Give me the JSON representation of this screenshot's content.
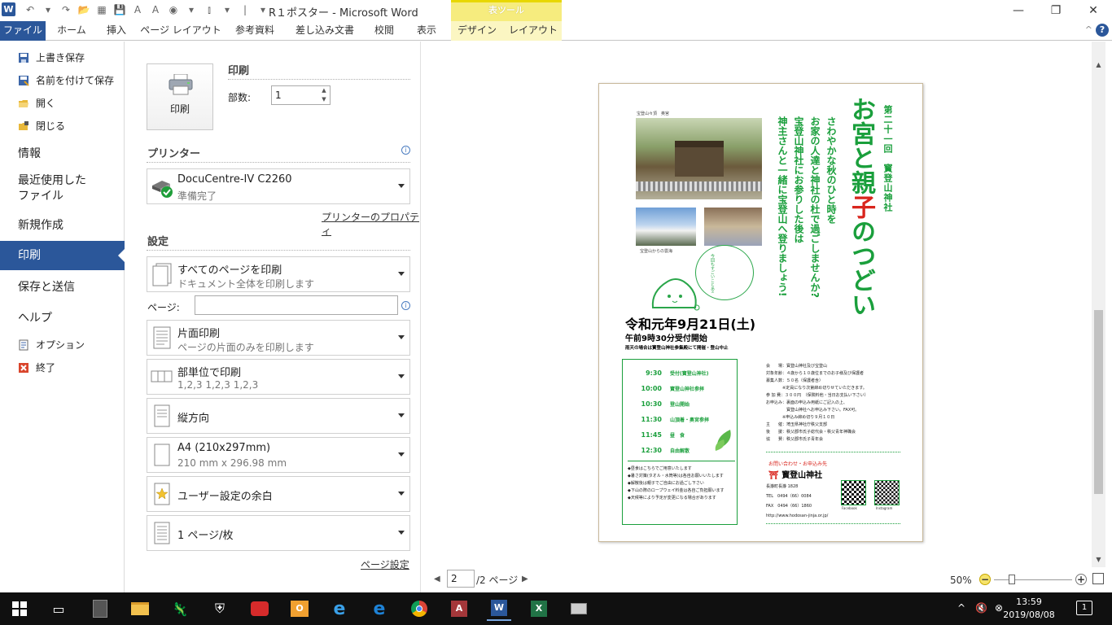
{
  "titlebar": {
    "title": "R１ポスター  -  Microsoft Word",
    "tool_group": "表ツール",
    "qat": [
      "↶",
      "▾",
      "↷",
      "📂",
      "▦",
      "💾",
      "A",
      "A",
      "◉",
      "▾",
      "⫾",
      "▾",
      "|",
      "▾"
    ],
    "controls": [
      "—",
      "❐",
      "✕"
    ]
  },
  "ribbon": {
    "tabs": [
      "ファイル",
      "ホーム",
      "挿入",
      "ページ レイアウト",
      "参考資料",
      "差し込み文書",
      "校閲",
      "表示",
      "デザイン",
      "レイアウト"
    ],
    "minimize": "^"
  },
  "nav": {
    "save": "上書き保存",
    "save_as": "名前を付けて保存",
    "open": "開く",
    "close": "閉じる",
    "info": "情報",
    "recent_line1": "最近使用した",
    "recent_line2": "ファイル",
    "new": "新規作成",
    "print": "印刷",
    "save_send": "保存と送信",
    "help": "ヘルプ",
    "options": "オプション",
    "exit": "終了"
  },
  "print_panel": {
    "print_button": "印刷",
    "print_heading": "印刷",
    "copies_label": "部数:",
    "copies_value": "1",
    "printer_heading": "プリンター",
    "printer_name": "DocuCentre-IV C2260",
    "printer_status": "準備完了",
    "printer_properties": "プリンターのプロパティ",
    "settings_heading": "設定",
    "pages_label": "ページ:",
    "pages_value": "",
    "settings": [
      {
        "line1": "すべてのページを印刷",
        "line2": "ドキュメント全体を印刷します"
      },
      {
        "line1": "片面印刷",
        "line2": "ページの片面のみを印刷します"
      },
      {
        "line1": "部単位で印刷",
        "line2": "1,2,3    1,2,3    1,2,3"
      },
      {
        "line1": "縦方向",
        "line2": ""
      },
      {
        "line1": "A4 (210x297mm)",
        "line2": "210 mm x 296.98 mm"
      },
      {
        "line1": "ユーザー設定の余白",
        "line2": ""
      },
      {
        "line1": "1 ページ/枚",
        "line2": ""
      }
    ],
    "page_setup": "ページ設定"
  },
  "preview": {
    "current_page": "2",
    "page_of": "/2 ページ",
    "zoom": "50%",
    "zoom_level_percent": 50
  },
  "poster": {
    "kicker": "第二十一回　寳登山神社",
    "headline_a": "お宮と親",
    "headline_b": "子",
    "headline_c": "のつどい",
    "intro": [
      "さわやかな秋のひと時を",
      "お家の人達と神社の杜で過ごしませんか?",
      "宝登山神社にお参りした後は",
      "神主さんと一緒に宝登山へ登りましょう!"
    ],
    "photo_caption_top": "宝登山々頂　奥宮",
    "photo_caption_bottom": "宝登山からの雲海",
    "date": "令和元年9月21日(土)",
    "reception": "午前9時30分受付開始",
    "rain_note": "雨天の場合は寳登山神社参集殿にて開催・登山中止",
    "schedule": [
      {
        "time": "9:30",
        "item": "受付(寳登山神社)"
      },
      {
        "time": "10:00",
        "item": "寳登山神社参拝"
      },
      {
        "time": "10:30",
        "item": "登山開始"
      },
      {
        "time": "11:30",
        "item": "山頂着・奥宮参拝"
      },
      {
        "time": "11:45",
        "item": "昼　食"
      },
      {
        "time": "12:30",
        "item": "自由解散"
      }
    ],
    "notes": [
      "◆昼食はこちらでご用意いたします",
      "◆暑さ対策(タオル・水筒等)は各自お願いいたします",
      "◆解散後は親子でご自由にお過ごし下さい",
      "◆下山の際のロープウェイ料金は各自ご負担願います",
      "◆天候等により予定が変更になる場合があります"
    ],
    "details": [
      "会　　場：寳登山神社及び宝登山",
      "対象年齢：４歳から１０歳位までのお子様及び保護者",
      "募集人数：５０名（保護者含）",
      "　　　　※定員になり次第締め切りせていただきます。",
      "参 加 費：３００円　（保険料他・当日お支払い下さい）",
      "お申込み：裏面の申込み用紙にご記入の上、",
      "　　　　　寳登山神社へお申込み下さい。FAX可。",
      "　　　　※申込み締め切り９月１０日",
      "主　　催：埼玉県神社庁秩父支部",
      "後　　援：秩父郡市氏子総代会・秩父青年神職会",
      "協　　賛：秩父郡市氏子青年会"
    ],
    "contact_label": "お問い合わせ・お申込み先",
    "shrine_name": "寳登山神社",
    "address": "長瀞町長瀞 1828",
    "tel": "TEL　0494（66）0084",
    "fax": "FAX　0494（66）1860",
    "url": "http://www.hodosan-jinja.or.jp/",
    "qr_labels": [
      "Facebook",
      "Instagram"
    ],
    "bubble": "今回もすごいことあるみたいだよ!!"
  },
  "taskbar": {
    "time": "13:59",
    "date": "2019/08/08",
    "notifications": "1"
  },
  "colors": {
    "accent": "#2b579a",
    "poster_green": "#1a9f3c",
    "poster_red": "#d9251d",
    "tool_yellow": "#f6ec7e"
  }
}
